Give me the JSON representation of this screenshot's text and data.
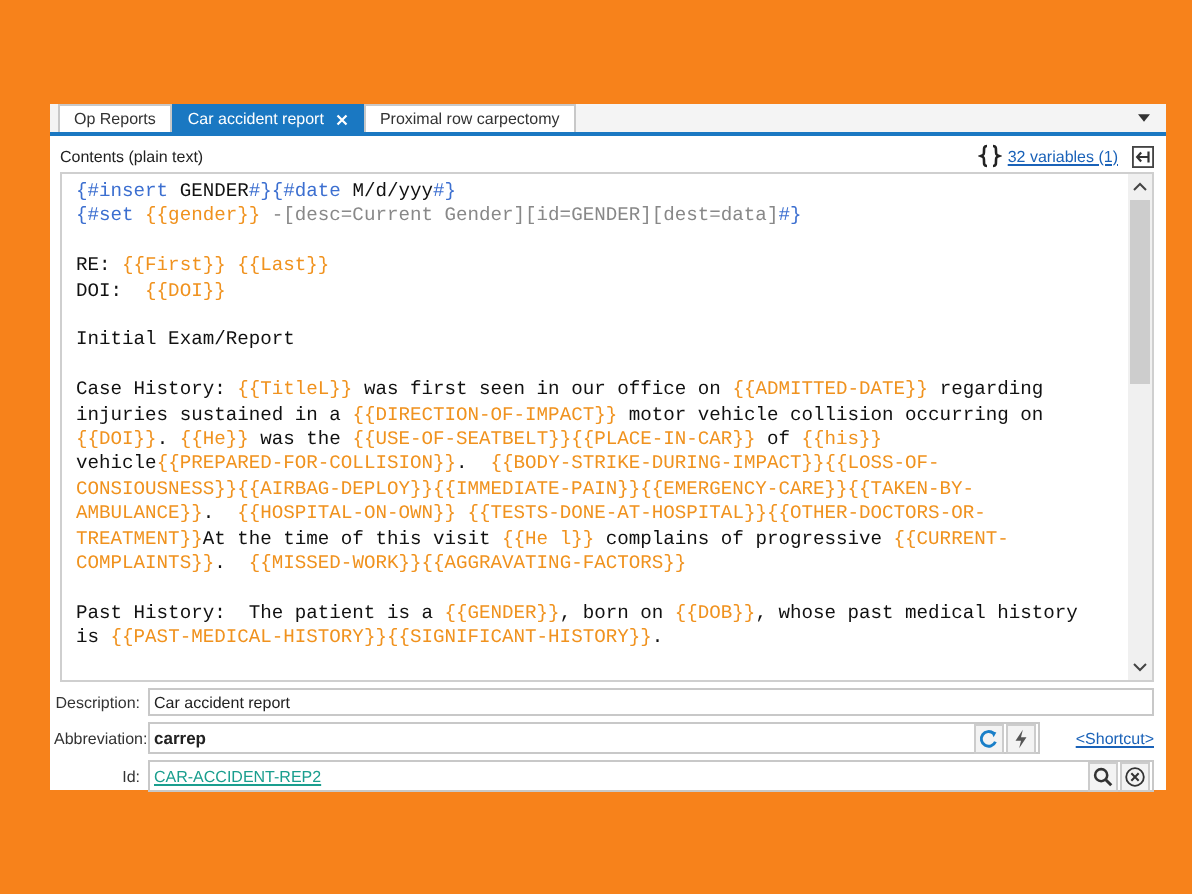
{
  "tabs": [
    {
      "label": "Op Reports",
      "selected": false
    },
    {
      "label": "Car accident report",
      "selected": true
    },
    {
      "label": "Proximal row carpectomy",
      "selected": false
    }
  ],
  "contents_label": "Contents (plain text)",
  "variables_link": "32 variables (1)",
  "editor": {
    "paragraphs": [
      [
        [
          {
            "kind": "directive",
            "text": "{#insert "
          },
          {
            "kind": "plain",
            "text": "GENDER"
          },
          {
            "kind": "directive",
            "text": "#}{#date "
          },
          {
            "kind": "plain",
            "text": "M/d/yyy"
          },
          {
            "kind": "directive",
            "text": "#}"
          }
        ],
        [
          {
            "kind": "directive",
            "text": "{#set "
          },
          {
            "kind": "var",
            "text": "{{gender}}"
          },
          {
            "kind": "desc",
            "text": " -[desc=Current Gender][id=GENDER][dest=data]"
          },
          {
            "kind": "directive",
            "text": "#}"
          }
        ]
      ],
      [
        [
          {
            "kind": "plain",
            "text": "RE: "
          },
          {
            "kind": "var",
            "text": "{{First}}"
          },
          {
            "kind": "var",
            "text": " {{Last}}"
          }
        ],
        [
          {
            "kind": "plain",
            "text": "DOI:  "
          },
          {
            "kind": "var",
            "text": "{{DOI}}"
          }
        ]
      ],
      [
        [
          {
            "kind": "plain",
            "text": "Initial Exam/Report"
          }
        ]
      ],
      [
        [
          {
            "kind": "plain",
            "text": "Case History: "
          },
          {
            "kind": "var",
            "text": "{{TitleL}}"
          },
          {
            "kind": "plain",
            "text": " was first seen in our office on "
          },
          {
            "kind": "var",
            "text": "{{ADMITTED-DATE}}"
          },
          {
            "kind": "plain",
            "text": " regarding"
          }
        ],
        [
          {
            "kind": "plain",
            "text": "injuries sustained in a "
          },
          {
            "kind": "var",
            "text": "{{DIRECTION-OF-IMPACT}}"
          },
          {
            "kind": "plain",
            "text": " motor vehicle collision occurring on"
          }
        ],
        [
          {
            "kind": "var",
            "text": "{{DOI}}"
          },
          {
            "kind": "plain",
            "text": ". "
          },
          {
            "kind": "var",
            "text": "{{He}}"
          },
          {
            "kind": "plain",
            "text": " was the "
          },
          {
            "kind": "var",
            "text": "{{USE-OF-SEATBELT}}{{PLACE-IN-CAR}}"
          },
          {
            "kind": "plain",
            "text": " of "
          },
          {
            "kind": "var",
            "text": "{{his}}"
          }
        ],
        [
          {
            "kind": "plain",
            "text": "vehicle"
          },
          {
            "kind": "var",
            "text": "{{PREPARED-FOR-COLLISION}}"
          },
          {
            "kind": "plain",
            "text": ".  "
          },
          {
            "kind": "var",
            "text": "{{BODY-STRIKE-DURING-IMPACT}}{{LOSS-OF-"
          }
        ],
        [
          {
            "kind": "var",
            "text": "CONSIOUSNESS}}{{AIRBAG-DEPLOY}}{{IMMEDIATE-PAIN}}{{EMERGENCY-CARE}}{{TAKEN-BY-"
          }
        ],
        [
          {
            "kind": "var",
            "text": "AMBULANCE}}"
          },
          {
            "kind": "plain",
            "text": ".  "
          },
          {
            "kind": "var",
            "text": "{{HOSPITAL-ON-OWN}}"
          },
          {
            "kind": "var",
            "text": " {{TESTS-DONE-AT-HOSPITAL}}{{OTHER-DOCTORS-OR-"
          }
        ],
        [
          {
            "kind": "var",
            "text": "TREATMENT}}"
          },
          {
            "kind": "plain",
            "text": "At the time of this visit "
          },
          {
            "kind": "var",
            "text": "{{He l}}"
          },
          {
            "kind": "plain",
            "text": " complains of progressive "
          },
          {
            "kind": "var",
            "text": "{{CURRENT-"
          }
        ],
        [
          {
            "kind": "var",
            "text": "COMPLAINTS}}"
          },
          {
            "kind": "plain",
            "text": ".  "
          },
          {
            "kind": "var",
            "text": "{{MISSED-WORK}}{{AGGRAVATING-FACTORS}}"
          }
        ]
      ],
      [
        [
          {
            "kind": "plain",
            "text": "Past History:  The patient is a "
          },
          {
            "kind": "var",
            "text": "{{GENDER}}"
          },
          {
            "kind": "plain",
            "text": ", born on "
          },
          {
            "kind": "var",
            "text": "{{DOB}}"
          },
          {
            "kind": "plain",
            "text": ", whose past medical history"
          }
        ],
        [
          {
            "kind": "plain",
            "text": "is "
          },
          {
            "kind": "var",
            "text": "{{PAST-MEDICAL-HISTORY}}{{SIGNIFICANT-HISTORY}}"
          },
          {
            "kind": "plain",
            "text": "."
          }
        ]
      ]
    ]
  },
  "description": {
    "label": "Description:",
    "value": "Car accident report"
  },
  "abbreviation": {
    "label": "Abbreviation:",
    "value": "carrep",
    "shortcut_link": "<Shortcut>"
  },
  "id": {
    "label": "Id:",
    "value": "CAR-ACCIDENT-REP2"
  }
}
